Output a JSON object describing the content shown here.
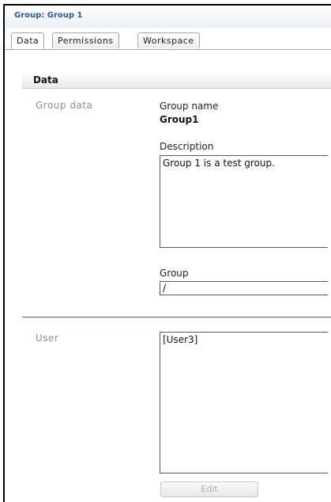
{
  "window": {
    "title": "Group: Group 1"
  },
  "tabs": [
    {
      "label": "Data",
      "active": true
    },
    {
      "label": "Permissions",
      "active": false
    },
    {
      "label": "Workspace",
      "active": false
    }
  ],
  "section": {
    "header": "Data"
  },
  "group_data": {
    "section_label": "Group data",
    "name_label": "Group name",
    "name_value": "Group1",
    "description_label": "Description",
    "description_value": "Group 1 is a test group.",
    "group_label": "Group",
    "group_value": "/"
  },
  "users": {
    "section_label": "User",
    "items": [
      "[User3]"
    ],
    "edit_button": "Edit"
  }
}
